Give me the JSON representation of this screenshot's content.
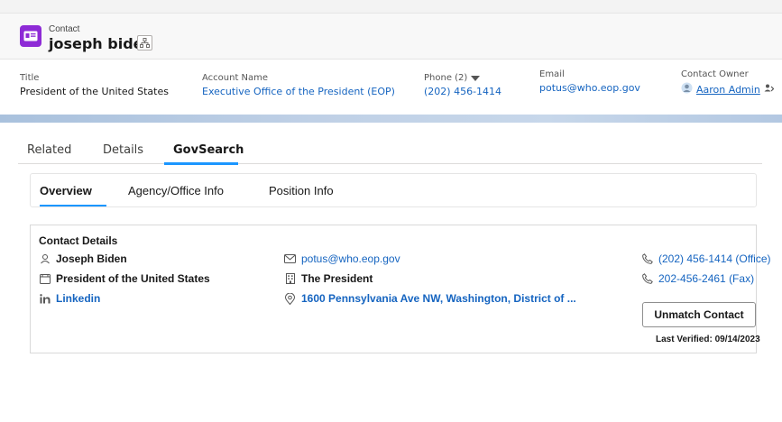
{
  "header": {
    "object_type": "Contact",
    "record_name": "joseph biden",
    "icon": "contact-card-icon",
    "icon_color": "#8e2bd6"
  },
  "highlights": {
    "title_label": "Title",
    "title_value": "President of the United States",
    "account_label": "Account Name",
    "account_value": "Executive Office of the President (EOP)",
    "phone_label": "Phone (2)",
    "phone_value": "(202) 456-1414",
    "email_label": "Email",
    "email_value": "potus@who.eop.gov",
    "owner_label": "Contact Owner",
    "owner_value": "Aaron Admin"
  },
  "tabs": [
    "Related",
    "Details",
    "GovSearch"
  ],
  "active_tab": "GovSearch",
  "subtabs": [
    "Overview",
    "Agency/Office Info",
    "Position Info"
  ],
  "active_subtab": "Overview",
  "contact_details": {
    "title": "Contact Details",
    "name": "Joseph Biden",
    "position": "President of the United States",
    "linkedin": "Linkedin",
    "email": "potus@who.eop.gov",
    "office": "The President",
    "address": "1600 Pennsylvania Ave NW, Washington, District of ...",
    "phone_office": "(202) 456-1414 (Office)",
    "phone_fax": "202-456-2461 (Fax)",
    "unmatch_label": "Unmatch Contact",
    "last_verified": "Last Verified: 09/14/2023"
  },
  "colors": {
    "link": "#1564c0",
    "accent": "#1b96ff"
  }
}
